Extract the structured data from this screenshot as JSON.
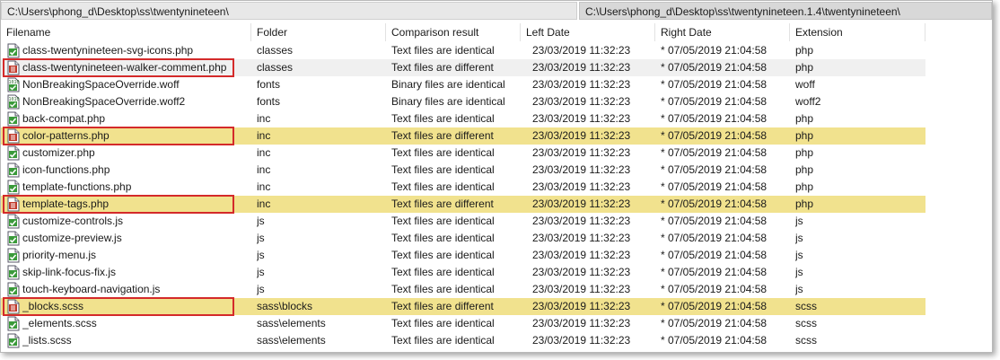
{
  "paths": {
    "left": "C:\\Users\\phong_d\\Desktop\\ss\\twentynineteen\\",
    "right": "C:\\Users\\phong_d\\Desktop\\ss\\twentynineteen.1.4\\twentynineteen\\"
  },
  "columns": [
    "Filename",
    "Folder",
    "Comparison result",
    "Left Date",
    "Right Date",
    "Extension"
  ],
  "colors": {
    "different_row": "#f1e28e",
    "highlight_box": "#d42a2a",
    "identical_icon": "#2e8b2e",
    "different_icon": "#c0392b"
  },
  "rows": [
    {
      "name": "class-twentynineteen-svg-icons.php",
      "folder": "classes",
      "result": "Text files are identical",
      "left": "23/03/2019 11:32:23",
      "right": "* 07/05/2019 21:04:58",
      "ext": "php",
      "icon": "identical-file-icon",
      "diff": false,
      "sel": false,
      "boxed": false
    },
    {
      "name": "class-twentynineteen-walker-comment.php",
      "folder": "classes",
      "result": "Text files are different",
      "left": "23/03/2019 11:32:23",
      "right": "* 07/05/2019 21:04:58",
      "ext": "php",
      "icon": "different-file-icon",
      "diff": false,
      "sel": true,
      "boxed": true
    },
    {
      "name": "NonBreakingSpaceOverride.woff",
      "folder": "fonts",
      "result": "Binary files are identical",
      "left": "23/03/2019 11:32:23",
      "right": "* 07/05/2019 21:04:58",
      "ext": "woff",
      "icon": "binary-file-icon",
      "diff": false,
      "sel": false,
      "boxed": false
    },
    {
      "name": "NonBreakingSpaceOverride.woff2",
      "folder": "fonts",
      "result": "Binary files are identical",
      "left": "23/03/2019 11:32:23",
      "right": "* 07/05/2019 21:04:58",
      "ext": "woff2",
      "icon": "binary-file-icon",
      "diff": false,
      "sel": false,
      "boxed": false
    },
    {
      "name": "back-compat.php",
      "folder": "inc",
      "result": "Text files are identical",
      "left": "23/03/2019 11:32:23",
      "right": "* 07/05/2019 21:04:58",
      "ext": "php",
      "icon": "identical-file-icon",
      "diff": false,
      "sel": false,
      "boxed": false
    },
    {
      "name": "color-patterns.php",
      "folder": "inc",
      "result": "Text files are different",
      "left": "23/03/2019 11:32:23",
      "right": "* 07/05/2019 21:04:58",
      "ext": "php",
      "icon": "different-file-icon",
      "diff": true,
      "sel": false,
      "boxed": true
    },
    {
      "name": "customizer.php",
      "folder": "inc",
      "result": "Text files are identical",
      "left": "23/03/2019 11:32:23",
      "right": "* 07/05/2019 21:04:58",
      "ext": "php",
      "icon": "identical-file-icon",
      "diff": false,
      "sel": false,
      "boxed": false
    },
    {
      "name": "icon-functions.php",
      "folder": "inc",
      "result": "Text files are identical",
      "left": "23/03/2019 11:32:23",
      "right": "* 07/05/2019 21:04:58",
      "ext": "php",
      "icon": "identical-file-icon",
      "diff": false,
      "sel": false,
      "boxed": false
    },
    {
      "name": "template-functions.php",
      "folder": "inc",
      "result": "Text files are identical",
      "left": "23/03/2019 11:32:23",
      "right": "* 07/05/2019 21:04:58",
      "ext": "php",
      "icon": "identical-file-icon",
      "diff": false,
      "sel": false,
      "boxed": false
    },
    {
      "name": "template-tags.php",
      "folder": "inc",
      "result": "Text files are different",
      "left": "23/03/2019 11:32:23",
      "right": "* 07/05/2019 21:04:58",
      "ext": "php",
      "icon": "different-file-icon",
      "diff": true,
      "sel": false,
      "boxed": true
    },
    {
      "name": "customize-controls.js",
      "folder": "js",
      "result": "Text files are identical",
      "left": "23/03/2019 11:32:23",
      "right": "* 07/05/2019 21:04:58",
      "ext": "js",
      "icon": "identical-file-icon",
      "diff": false,
      "sel": false,
      "boxed": false
    },
    {
      "name": "customize-preview.js",
      "folder": "js",
      "result": "Text files are identical",
      "left": "23/03/2019 11:32:23",
      "right": "* 07/05/2019 21:04:58",
      "ext": "js",
      "icon": "identical-file-icon",
      "diff": false,
      "sel": false,
      "boxed": false
    },
    {
      "name": "priority-menu.js",
      "folder": "js",
      "result": "Text files are identical",
      "left": "23/03/2019 11:32:23",
      "right": "* 07/05/2019 21:04:58",
      "ext": "js",
      "icon": "identical-file-icon",
      "diff": false,
      "sel": false,
      "boxed": false
    },
    {
      "name": "skip-link-focus-fix.js",
      "folder": "js",
      "result": "Text files are identical",
      "left": "23/03/2019 11:32:23",
      "right": "* 07/05/2019 21:04:58",
      "ext": "js",
      "icon": "identical-file-icon",
      "diff": false,
      "sel": false,
      "boxed": false
    },
    {
      "name": "touch-keyboard-navigation.js",
      "folder": "js",
      "result": "Text files are identical",
      "left": "23/03/2019 11:32:23",
      "right": "* 07/05/2019 21:04:58",
      "ext": "js",
      "icon": "identical-file-icon",
      "diff": false,
      "sel": false,
      "boxed": false
    },
    {
      "name": "_blocks.scss",
      "folder": "sass\\blocks",
      "result": "Text files are different",
      "left": "23/03/2019 11:32:23",
      "right": "* 07/05/2019 21:04:58",
      "ext": "scss",
      "icon": "different-file-icon",
      "diff": true,
      "sel": false,
      "boxed": true
    },
    {
      "name": "_elements.scss",
      "folder": "sass\\elements",
      "result": "Text files are identical",
      "left": "23/03/2019 11:32:23",
      "right": "* 07/05/2019 21:04:58",
      "ext": "scss",
      "icon": "identical-file-icon",
      "diff": false,
      "sel": false,
      "boxed": false
    },
    {
      "name": "_lists.scss",
      "folder": "sass\\elements",
      "result": "Text files are identical",
      "left": "23/03/2019 11:32:23",
      "right": "* 07/05/2019 21:04:58",
      "ext": "scss",
      "icon": "identical-file-icon",
      "diff": false,
      "sel": false,
      "boxed": false
    }
  ]
}
